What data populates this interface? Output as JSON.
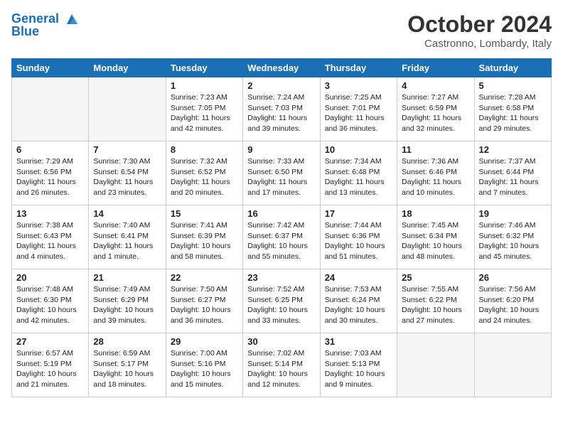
{
  "header": {
    "logo_line1": "General",
    "logo_line2": "Blue",
    "month": "October 2024",
    "location": "Castronno, Lombardy, Italy"
  },
  "days_of_week": [
    "Sunday",
    "Monday",
    "Tuesday",
    "Wednesday",
    "Thursday",
    "Friday",
    "Saturday"
  ],
  "weeks": [
    [
      {
        "day": "",
        "info": ""
      },
      {
        "day": "",
        "info": ""
      },
      {
        "day": "1",
        "info": "Sunrise: 7:23 AM\nSunset: 7:05 PM\nDaylight: 11 hours\nand 42 minutes."
      },
      {
        "day": "2",
        "info": "Sunrise: 7:24 AM\nSunset: 7:03 PM\nDaylight: 11 hours\nand 39 minutes."
      },
      {
        "day": "3",
        "info": "Sunrise: 7:25 AM\nSunset: 7:01 PM\nDaylight: 11 hours\nand 36 minutes."
      },
      {
        "day": "4",
        "info": "Sunrise: 7:27 AM\nSunset: 6:59 PM\nDaylight: 11 hours\nand 32 minutes."
      },
      {
        "day": "5",
        "info": "Sunrise: 7:28 AM\nSunset: 6:58 PM\nDaylight: 11 hours\nand 29 minutes."
      }
    ],
    [
      {
        "day": "6",
        "info": "Sunrise: 7:29 AM\nSunset: 6:56 PM\nDaylight: 11 hours\nand 26 minutes."
      },
      {
        "day": "7",
        "info": "Sunrise: 7:30 AM\nSunset: 6:54 PM\nDaylight: 11 hours\nand 23 minutes."
      },
      {
        "day": "8",
        "info": "Sunrise: 7:32 AM\nSunset: 6:52 PM\nDaylight: 11 hours\nand 20 minutes."
      },
      {
        "day": "9",
        "info": "Sunrise: 7:33 AM\nSunset: 6:50 PM\nDaylight: 11 hours\nand 17 minutes."
      },
      {
        "day": "10",
        "info": "Sunrise: 7:34 AM\nSunset: 6:48 PM\nDaylight: 11 hours\nand 13 minutes."
      },
      {
        "day": "11",
        "info": "Sunrise: 7:36 AM\nSunset: 6:46 PM\nDaylight: 11 hours\nand 10 minutes."
      },
      {
        "day": "12",
        "info": "Sunrise: 7:37 AM\nSunset: 6:44 PM\nDaylight: 11 hours\nand 7 minutes."
      }
    ],
    [
      {
        "day": "13",
        "info": "Sunrise: 7:38 AM\nSunset: 6:43 PM\nDaylight: 11 hours\nand 4 minutes."
      },
      {
        "day": "14",
        "info": "Sunrise: 7:40 AM\nSunset: 6:41 PM\nDaylight: 11 hours\nand 1 minute."
      },
      {
        "day": "15",
        "info": "Sunrise: 7:41 AM\nSunset: 6:39 PM\nDaylight: 10 hours\nand 58 minutes."
      },
      {
        "day": "16",
        "info": "Sunrise: 7:42 AM\nSunset: 6:37 PM\nDaylight: 10 hours\nand 55 minutes."
      },
      {
        "day": "17",
        "info": "Sunrise: 7:44 AM\nSunset: 6:36 PM\nDaylight: 10 hours\nand 51 minutes."
      },
      {
        "day": "18",
        "info": "Sunrise: 7:45 AM\nSunset: 6:34 PM\nDaylight: 10 hours\nand 48 minutes."
      },
      {
        "day": "19",
        "info": "Sunrise: 7:46 AM\nSunset: 6:32 PM\nDaylight: 10 hours\nand 45 minutes."
      }
    ],
    [
      {
        "day": "20",
        "info": "Sunrise: 7:48 AM\nSunset: 6:30 PM\nDaylight: 10 hours\nand 42 minutes."
      },
      {
        "day": "21",
        "info": "Sunrise: 7:49 AM\nSunset: 6:29 PM\nDaylight: 10 hours\nand 39 minutes."
      },
      {
        "day": "22",
        "info": "Sunrise: 7:50 AM\nSunset: 6:27 PM\nDaylight: 10 hours\nand 36 minutes."
      },
      {
        "day": "23",
        "info": "Sunrise: 7:52 AM\nSunset: 6:25 PM\nDaylight: 10 hours\nand 33 minutes."
      },
      {
        "day": "24",
        "info": "Sunrise: 7:53 AM\nSunset: 6:24 PM\nDaylight: 10 hours\nand 30 minutes."
      },
      {
        "day": "25",
        "info": "Sunrise: 7:55 AM\nSunset: 6:22 PM\nDaylight: 10 hours\nand 27 minutes."
      },
      {
        "day": "26",
        "info": "Sunrise: 7:56 AM\nSunset: 6:20 PM\nDaylight: 10 hours\nand 24 minutes."
      }
    ],
    [
      {
        "day": "27",
        "info": "Sunrise: 6:57 AM\nSunset: 5:19 PM\nDaylight: 10 hours\nand 21 minutes."
      },
      {
        "day": "28",
        "info": "Sunrise: 6:59 AM\nSunset: 5:17 PM\nDaylight: 10 hours\nand 18 minutes."
      },
      {
        "day": "29",
        "info": "Sunrise: 7:00 AM\nSunset: 5:16 PM\nDaylight: 10 hours\nand 15 minutes."
      },
      {
        "day": "30",
        "info": "Sunrise: 7:02 AM\nSunset: 5:14 PM\nDaylight: 10 hours\nand 12 minutes."
      },
      {
        "day": "31",
        "info": "Sunrise: 7:03 AM\nSunset: 5:13 PM\nDaylight: 10 hours\nand 9 minutes."
      },
      {
        "day": "",
        "info": ""
      },
      {
        "day": "",
        "info": ""
      }
    ]
  ]
}
